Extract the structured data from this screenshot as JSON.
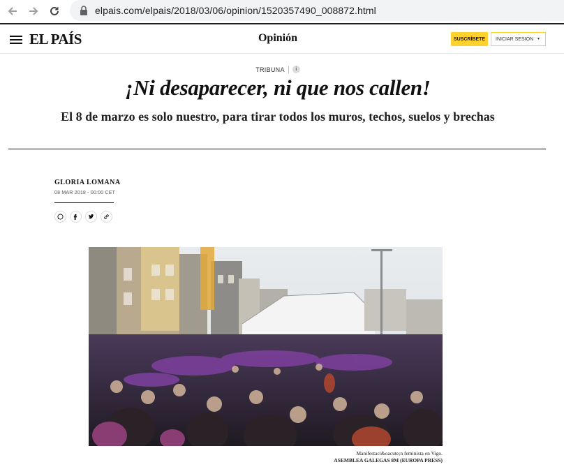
{
  "browser": {
    "url": "elpais.com/elpais/2018/03/06/opinion/1520357490_008872.html"
  },
  "header": {
    "logo": "EL PAÍS",
    "section": "Opinión",
    "subscribe_label": "SUSCRÍBETE",
    "login_label": "INICIAR SESIÓN",
    "accent_color": "#ffd22e"
  },
  "article": {
    "kicker": "TRIBUNA",
    "info_glyph": "i",
    "headline": "¡Ni desaparecer, ni que nos callen!",
    "subheadline": "El 8 de marzo es solo nuestro, para tirar todos los muros, techos, suelos y brechas",
    "author": "GLORIA LOMANA",
    "date": "08 MAR 2018 - 00:00 CET",
    "share_icons": [
      "whatsapp-icon",
      "facebook-icon",
      "twitter-icon",
      "link-icon"
    ],
    "caption": "Manifestaci&oacute;n feminista en Vigo.",
    "credit": "ASEMBLEA GALEGAS 8M (EUROPA PRESS)"
  }
}
